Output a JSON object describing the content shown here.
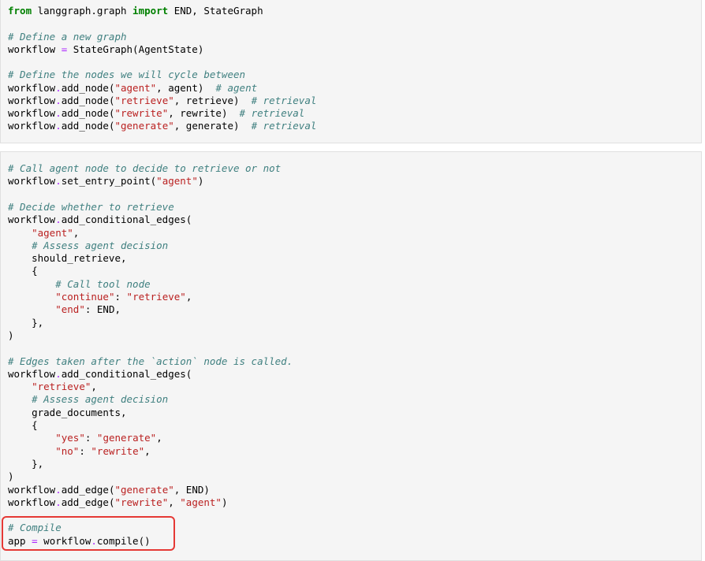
{
  "cells": [
    {
      "id": "cell-1",
      "lines": [
        [
          {
            "t": "kw",
            "v": "from"
          },
          {
            "t": "tx",
            "v": " langgraph.graph "
          },
          {
            "t": "kw",
            "v": "import"
          },
          {
            "t": "tx",
            "v": " END, StateGraph"
          }
        ],
        [],
        [
          {
            "t": "cm",
            "v": "# Define a new graph"
          }
        ],
        [
          {
            "t": "tx",
            "v": "workflow "
          },
          {
            "t": "op",
            "v": "="
          },
          {
            "t": "tx",
            "v": " StateGraph(AgentState)"
          }
        ],
        [],
        [
          {
            "t": "cm",
            "v": "# Define the nodes we will cycle between"
          }
        ],
        [
          {
            "t": "tx",
            "v": "workflow"
          },
          {
            "t": "op",
            "v": "."
          },
          {
            "t": "tx",
            "v": "add_node("
          },
          {
            "t": "st",
            "v": "\"agent\""
          },
          {
            "t": "tx",
            "v": ", agent)  "
          },
          {
            "t": "cm",
            "v": "# agent"
          }
        ],
        [
          {
            "t": "tx",
            "v": "workflow"
          },
          {
            "t": "op",
            "v": "."
          },
          {
            "t": "tx",
            "v": "add_node("
          },
          {
            "t": "st",
            "v": "\"retrieve\""
          },
          {
            "t": "tx",
            "v": ", retrieve)  "
          },
          {
            "t": "cm",
            "v": "# retrieval"
          }
        ],
        [
          {
            "t": "tx",
            "v": "workflow"
          },
          {
            "t": "op",
            "v": "."
          },
          {
            "t": "tx",
            "v": "add_node("
          },
          {
            "t": "st",
            "v": "\"rewrite\""
          },
          {
            "t": "tx",
            "v": ", rewrite)  "
          },
          {
            "t": "cm",
            "v": "# retrieval"
          }
        ],
        [
          {
            "t": "tx",
            "v": "workflow"
          },
          {
            "t": "op",
            "v": "."
          },
          {
            "t": "tx",
            "v": "add_node("
          },
          {
            "t": "st",
            "v": "\"generate\""
          },
          {
            "t": "tx",
            "v": ", generate)  "
          },
          {
            "t": "cm",
            "v": "# retrieval"
          }
        ]
      ]
    },
    {
      "id": "cell-2",
      "lines": [
        [
          {
            "t": "cm",
            "v": "# Call agent node to decide to retrieve or not"
          }
        ],
        [
          {
            "t": "tx",
            "v": "workflow"
          },
          {
            "t": "op",
            "v": "."
          },
          {
            "t": "tx",
            "v": "set_entry_point("
          },
          {
            "t": "st",
            "v": "\"agent\""
          },
          {
            "t": "tx",
            "v": ")"
          }
        ],
        [],
        [
          {
            "t": "cm",
            "v": "# Decide whether to retrieve"
          }
        ],
        [
          {
            "t": "tx",
            "v": "workflow"
          },
          {
            "t": "op",
            "v": "."
          },
          {
            "t": "tx",
            "v": "add_conditional_edges("
          }
        ],
        [
          {
            "t": "tx",
            "v": "    "
          },
          {
            "t": "st",
            "v": "\"agent\""
          },
          {
            "t": "tx",
            "v": ","
          }
        ],
        [
          {
            "t": "tx",
            "v": "    "
          },
          {
            "t": "cm",
            "v": "# Assess agent decision"
          }
        ],
        [
          {
            "t": "tx",
            "v": "    should_retrieve,"
          }
        ],
        [
          {
            "t": "tx",
            "v": "    {"
          }
        ],
        [
          {
            "t": "tx",
            "v": "        "
          },
          {
            "t": "cm",
            "v": "# Call tool node"
          }
        ],
        [
          {
            "t": "tx",
            "v": "        "
          },
          {
            "t": "st",
            "v": "\"continue\""
          },
          {
            "t": "tx",
            "v": ": "
          },
          {
            "t": "st",
            "v": "\"retrieve\""
          },
          {
            "t": "tx",
            "v": ","
          }
        ],
        [
          {
            "t": "tx",
            "v": "        "
          },
          {
            "t": "st",
            "v": "\"end\""
          },
          {
            "t": "tx",
            "v": ": END,"
          }
        ],
        [
          {
            "t": "tx",
            "v": "    },"
          }
        ],
        [
          {
            "t": "tx",
            "v": ")"
          }
        ],
        [],
        [
          {
            "t": "cm",
            "v": "# Edges taken after the `action` node is called."
          }
        ],
        [
          {
            "t": "tx",
            "v": "workflow"
          },
          {
            "t": "op",
            "v": "."
          },
          {
            "t": "tx",
            "v": "add_conditional_edges("
          }
        ],
        [
          {
            "t": "tx",
            "v": "    "
          },
          {
            "t": "st",
            "v": "\"retrieve\""
          },
          {
            "t": "tx",
            "v": ","
          }
        ],
        [
          {
            "t": "tx",
            "v": "    "
          },
          {
            "t": "cm",
            "v": "# Assess agent decision"
          }
        ],
        [
          {
            "t": "tx",
            "v": "    grade_documents,"
          }
        ],
        [
          {
            "t": "tx",
            "v": "    {"
          }
        ],
        [
          {
            "t": "tx",
            "v": "        "
          },
          {
            "t": "st",
            "v": "\"yes\""
          },
          {
            "t": "tx",
            "v": ": "
          },
          {
            "t": "st",
            "v": "\"generate\""
          },
          {
            "t": "tx",
            "v": ","
          }
        ],
        [
          {
            "t": "tx",
            "v": "        "
          },
          {
            "t": "st",
            "v": "\"no\""
          },
          {
            "t": "tx",
            "v": ": "
          },
          {
            "t": "st",
            "v": "\"rewrite\""
          },
          {
            "t": "tx",
            "v": ","
          }
        ],
        [
          {
            "t": "tx",
            "v": "    },"
          }
        ],
        [
          {
            "t": "tx",
            "v": ")"
          }
        ],
        [
          {
            "t": "tx",
            "v": "workflow"
          },
          {
            "t": "op",
            "v": "."
          },
          {
            "t": "tx",
            "v": "add_edge("
          },
          {
            "t": "st",
            "v": "\"generate\""
          },
          {
            "t": "tx",
            "v": ", END)"
          }
        ],
        [
          {
            "t": "tx",
            "v": "workflow"
          },
          {
            "t": "op",
            "v": "."
          },
          {
            "t": "tx",
            "v": "add_edge("
          },
          {
            "t": "st",
            "v": "\"rewrite\""
          },
          {
            "t": "tx",
            "v": ", "
          },
          {
            "t": "st",
            "v": "\"agent\""
          },
          {
            "t": "tx",
            "v": ")"
          }
        ],
        [],
        [
          {
            "t": "cm",
            "v": "# Compile"
          }
        ],
        [
          {
            "t": "tx",
            "v": "app "
          },
          {
            "t": "op",
            "v": "="
          },
          {
            "t": "tx",
            "v": " workflow"
          },
          {
            "t": "op",
            "v": "."
          },
          {
            "t": "tx",
            "v": "compile()"
          }
        ]
      ]
    }
  ],
  "colors": {
    "keyword": "#008000",
    "comment": "#408080",
    "string": "#ba2121",
    "operator": "#aa22ff",
    "highlight_border": "#e53935",
    "cell_background": "#f5f5f5"
  }
}
